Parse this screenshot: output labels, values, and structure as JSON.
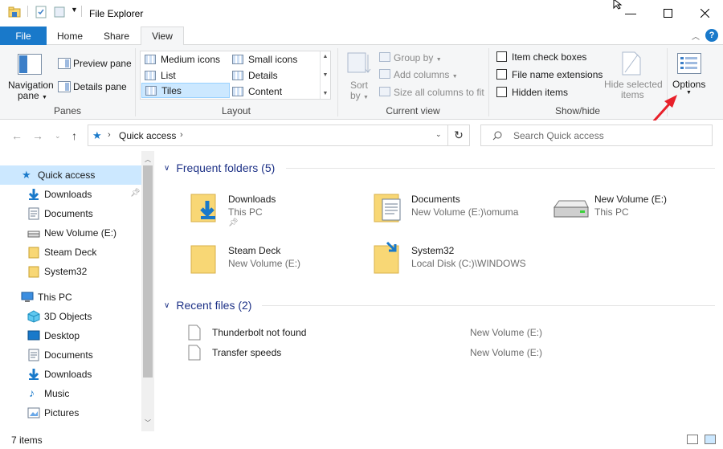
{
  "window": {
    "title": "File Explorer",
    "controls": [
      "minimize-icon",
      "maximize-icon",
      "close-icon"
    ]
  },
  "ribbon_tabs": [
    {
      "label": "File"
    },
    {
      "label": "Home"
    },
    {
      "label": "Share"
    },
    {
      "label": "View"
    }
  ],
  "ribbon": {
    "panes": {
      "navigation_pane_line1": "Navigation",
      "navigation_pane_line2": "pane",
      "preview_pane": "Preview pane",
      "details_pane": "Details pane",
      "group_label": "Panes"
    },
    "layout": {
      "items": [
        "Medium icons",
        "Small icons",
        "List",
        "Details",
        "Tiles",
        "Content"
      ],
      "selected": "Tiles",
      "group_label": "Layout"
    },
    "current_view": {
      "sort_by_line1": "Sort",
      "sort_by_line2": "by",
      "group_by": "Group by",
      "add_columns": "Add columns",
      "size_all_columns": "Size all columns to fit",
      "group_label": "Current view"
    },
    "show_hide": {
      "item_check_boxes": "Item check boxes",
      "file_name_extensions": "File name extensions",
      "hidden_items": "Hidden items",
      "hide_selected_line1": "Hide selected",
      "hide_selected_line2": "items",
      "group_label": "Show/hide"
    },
    "options": {
      "label": "Options"
    }
  },
  "address_bar": {
    "path": "Quick access",
    "search_placeholder": "Search Quick access"
  },
  "nav_pane": {
    "items": [
      {
        "label": "Quick access",
        "icon": "star-icon",
        "selected": true
      },
      {
        "label": "Downloads",
        "icon": "download-icon",
        "pinned": true
      },
      {
        "label": "Documents",
        "icon": "document-icon"
      },
      {
        "label": "New Volume (E:)",
        "icon": "drive-icon"
      },
      {
        "label": "Steam Deck",
        "icon": "folder-icon"
      },
      {
        "label": "System32",
        "icon": "folder-icon"
      },
      {
        "label": "This PC",
        "icon": "computer-icon"
      },
      {
        "label": "3D Objects",
        "icon": "cube-icon"
      },
      {
        "label": "Desktop",
        "icon": "desktop-icon"
      },
      {
        "label": "Documents",
        "icon": "document-icon"
      },
      {
        "label": "Downloads",
        "icon": "download-icon"
      },
      {
        "label": "Music",
        "icon": "music-icon"
      },
      {
        "label": "Pictures",
        "icon": "pictures-icon"
      }
    ]
  },
  "frequent_folders": {
    "heading": "Frequent folders (5)",
    "items": [
      {
        "name": "Downloads",
        "location": "This PC",
        "icon": "download-folder-icon",
        "pinned": true
      },
      {
        "name": "Documents",
        "location": "New Volume (E:)\\omuma",
        "icon": "documents-folder-icon"
      },
      {
        "name": "New Volume (E:)",
        "location": "This PC",
        "icon": "drive-icon"
      },
      {
        "name": "Steam Deck",
        "location": "New Volume (E:)",
        "icon": "folder-icon"
      },
      {
        "name": "System32",
        "location": "Local Disk (C:)\\WINDOWS",
        "icon": "system-folder-icon"
      }
    ]
  },
  "recent_files": {
    "heading": "Recent files (2)",
    "items": [
      {
        "name": "Thunderbolt not found",
        "location": "New Volume (E:)"
      },
      {
        "name": "Transfer speeds",
        "location": "New Volume (E:)"
      }
    ]
  },
  "status_bar": {
    "item_count": "7 items"
  },
  "colors": {
    "accent": "#1979ca",
    "selection": "#cce8ff",
    "heading": "#1e3287",
    "folder": "#f8d775",
    "annotation": "#e8202a"
  }
}
